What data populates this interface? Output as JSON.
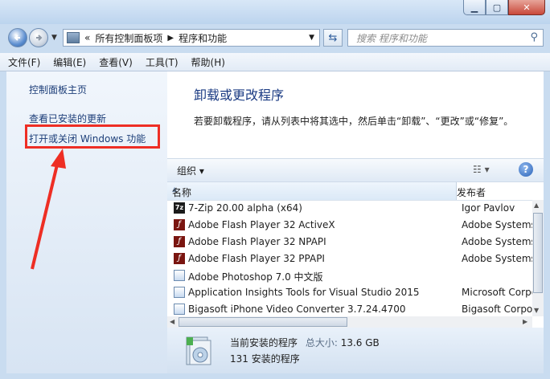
{
  "window": {
    "buttons": {
      "minimize": "▁",
      "maximize": "▢",
      "close": "✕"
    }
  },
  "nav": {
    "back_icon": "arrow-left",
    "forward_icon": "arrow-right",
    "breadcrumb": [
      "所有控制面板项",
      "程序和功能"
    ],
    "breadcrumb_prefix": "«",
    "search_placeholder": "搜索 程序和功能"
  },
  "menu": [
    "文件(F)",
    "编辑(E)",
    "查看(V)",
    "工具(T)",
    "帮助(H)"
  ],
  "sidebar": {
    "links": [
      "控制面板主页",
      "查看已安装的更新",
      "打开或关闭 Windows 功能"
    ],
    "highlight_color": "#ee2e24"
  },
  "main": {
    "title": "卸载或更改程序",
    "description": "若要卸载程序，请从列表中将其选中，然后单击“卸载”、“更改”或“修复”。"
  },
  "toolbar": {
    "organize": "组织 ▾",
    "view": "☷ ▾",
    "help": "?"
  },
  "table": {
    "columns": [
      "名称",
      "发布者"
    ],
    "rows": [
      {
        "icon": "7zip-icon",
        "name": "7-Zip 20.00 alpha (x64)",
        "publisher": "Igor Pavlov"
      },
      {
        "icon": "flash-icon",
        "name": "Adobe Flash Player 32 ActiveX",
        "publisher": "Adobe Systems"
      },
      {
        "icon": "flash-icon",
        "name": "Adobe Flash Player 32 NPAPI",
        "publisher": "Adobe Systems"
      },
      {
        "icon": "flash-icon",
        "name": "Adobe Flash Player 32 PPAPI",
        "publisher": "Adobe Systems"
      },
      {
        "icon": "program-icon",
        "name": "Adobe Photoshop 7.0 中文版",
        "publisher": ""
      },
      {
        "icon": "program-icon",
        "name": "Application Insights Tools for Visual Studio 2015",
        "publisher": "Microsoft Corporation"
      },
      {
        "icon": "program-icon",
        "name": "Bigasoft iPhone Video Converter 3.7.24.4700",
        "publisher": "Bigasoft Corporation"
      }
    ]
  },
  "details": {
    "label": "当前安装的程序",
    "size_label": "总大小:",
    "size_value": "13.6 GB",
    "count": "131 安装的程序"
  }
}
